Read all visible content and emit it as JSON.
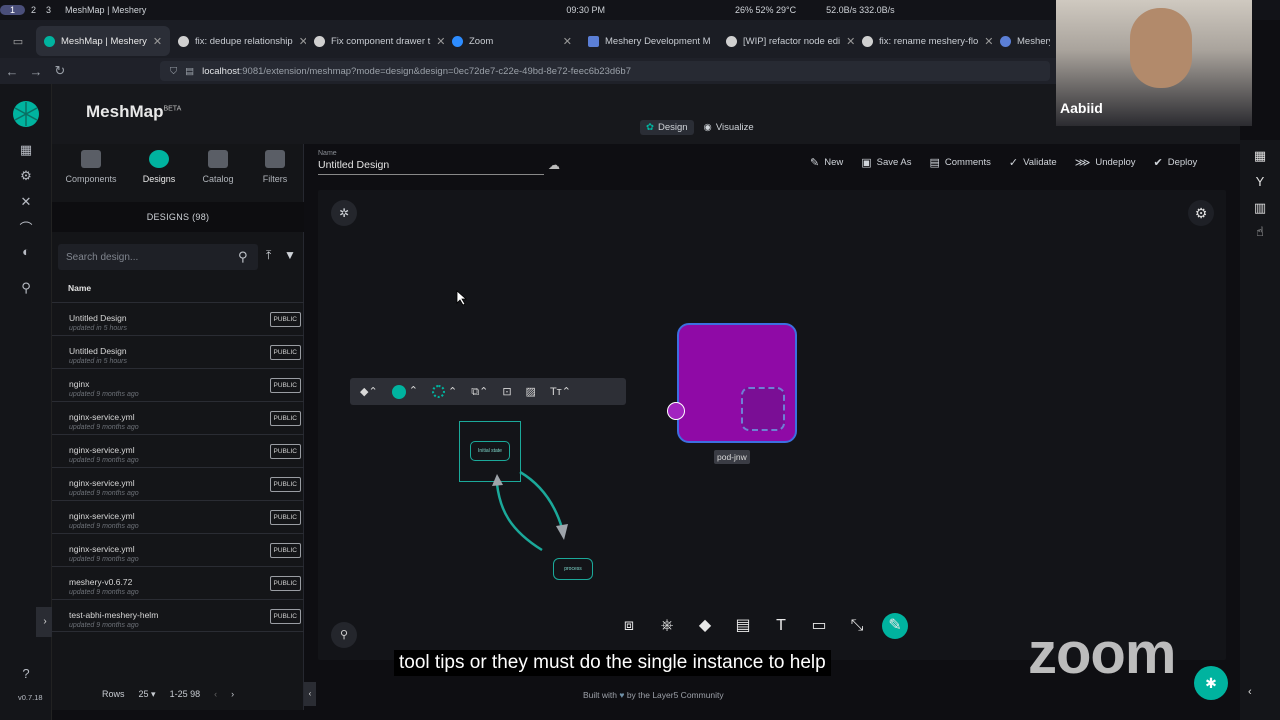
{
  "os_bar": {
    "workspaces": [
      "1",
      "2",
      "3"
    ],
    "app_label": "MeshMap | Meshery",
    "clock": "09:30 PM",
    "stats": "26%  52%  29°C",
    "net": "52.0B/s  332.0B/s"
  },
  "tabs": [
    {
      "label": "MeshMap | Meshery",
      "active": true
    },
    {
      "label": "fix: dedupe relationship"
    },
    {
      "label": "Fix component drawer t"
    },
    {
      "label": "Zoom"
    },
    {
      "label": "Meshery Development M"
    },
    {
      "label": "[WIP] refactor node edi"
    },
    {
      "label": "fix: rename meshery-flo"
    },
    {
      "label": "Meshery"
    }
  ],
  "url": {
    "host": "localhost",
    "rest": ":9081/extension/meshmap?mode=design&design=0ec72de7-c22e-49bd-8e72-feec6b23d6b7"
  },
  "app": {
    "title": "MeshMap",
    "beta": "BETA",
    "modes": {
      "design": "Design",
      "visualize": "Visualize"
    },
    "version": "v0.7.18"
  },
  "panel": {
    "tabs": [
      "Components",
      "Designs",
      "Catalog",
      "Filters"
    ],
    "designs_header": "DESIGNS (98)",
    "search_placeholder": "Search design...",
    "column_name": "Name",
    "rows": [
      {
        "name": "Untitled Design",
        "updated": "updated in 5 hours",
        "badge": "PUBLIC"
      },
      {
        "name": "Untitled Design",
        "updated": "updated in 5 hours",
        "badge": "PUBLIC"
      },
      {
        "name": "nginx",
        "updated": "updated 9 months ago",
        "badge": "PUBLIC"
      },
      {
        "name": "nginx-service.yml",
        "updated": "updated 9 months ago",
        "badge": "PUBLIC"
      },
      {
        "name": "nginx-service.yml",
        "updated": "updated 9 months ago",
        "badge": "PUBLIC"
      },
      {
        "name": "nginx-service.yml",
        "updated": "updated 9 months ago",
        "badge": "PUBLIC"
      },
      {
        "name": "nginx-service.yml",
        "updated": "updated 9 months ago",
        "badge": "PUBLIC"
      },
      {
        "name": "nginx-service.yml",
        "updated": "updated 9 months ago",
        "badge": "PUBLIC"
      },
      {
        "name": "meshery-v0.6.72",
        "updated": "updated 9 months ago",
        "badge": "PUBLIC"
      },
      {
        "name": "test-abhi-meshery-helm",
        "updated": "updated 9 months ago",
        "badge": "PUBLIC"
      }
    ],
    "pager": {
      "rows_label": "Rows",
      "rows_value": "25",
      "range": "1-25 98"
    }
  },
  "editor": {
    "name_label": "Name",
    "name_value": "Untitled Design",
    "actions": [
      "New",
      "Save As",
      "Comments",
      "Validate",
      "Undeploy",
      "Deploy"
    ]
  },
  "canvas": {
    "pod_label": "pod-jnw",
    "init_node": "Initial state",
    "process_node": "process",
    "pod_color": "#8f0aa6",
    "accent": "#00b39f"
  },
  "caption": "tool tips or they must do the single instance to help",
  "footer": {
    "built_with": "Built with",
    "by": "by the Layer5 Community"
  },
  "webcam": {
    "name": "Aabiid"
  },
  "zoom_watermark": "zoom"
}
